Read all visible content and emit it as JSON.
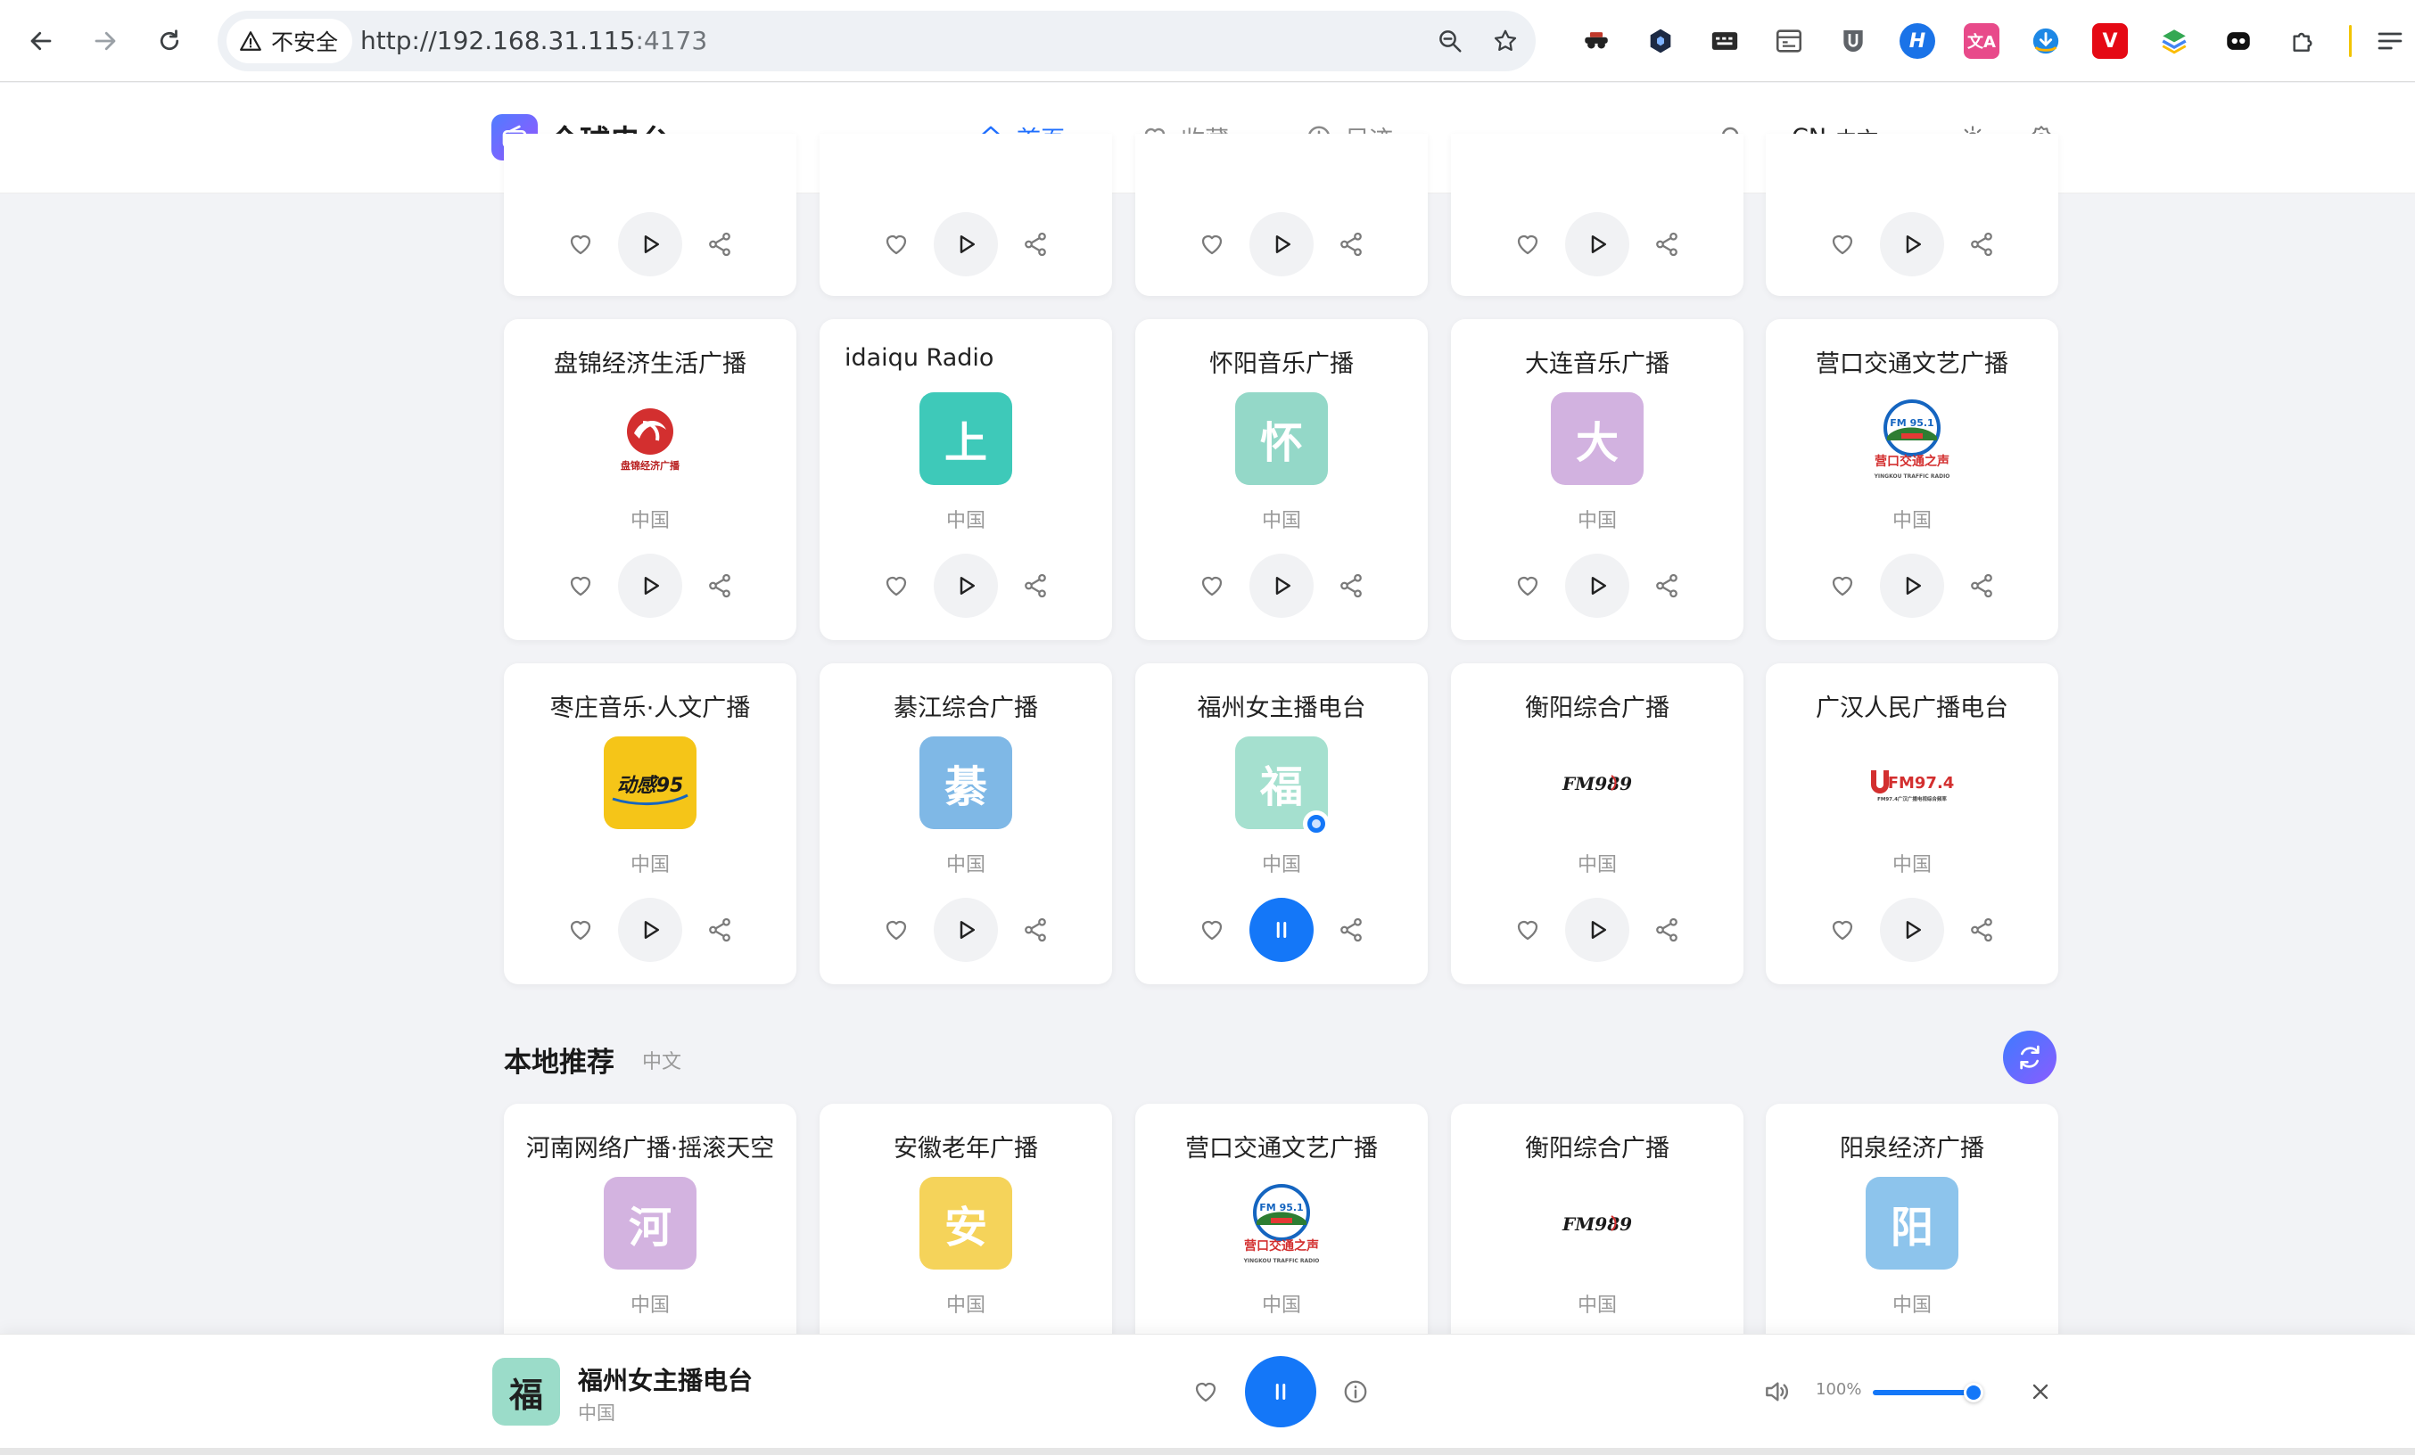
{
  "browser": {
    "security_label": "不安全",
    "url_host": "http://192.168.31.115",
    "url_port": ":4173"
  },
  "header": {
    "logo_text": "全球电台",
    "nav": [
      {
        "label": "首页",
        "active": true
      },
      {
        "label": "收藏",
        "active": false
      },
      {
        "label": "足迹",
        "active": false
      }
    ],
    "lang_code": "CN",
    "lang_label": "中文"
  },
  "grid": {
    "rows": [
      {
        "cards": [
          {
            "name": "",
            "country": "",
            "playing": false
          },
          {
            "name": "",
            "country": "",
            "playing": false
          },
          {
            "name": "",
            "country": "",
            "playing": false
          },
          {
            "name": "",
            "country": "",
            "playing": false
          },
          {
            "name": "",
            "country": "",
            "playing": false
          }
        ]
      },
      {
        "cards": [
          {
            "name": "盘锦经济生活广播",
            "country": "中国",
            "logo_char": "",
            "logo_color": "#ffffff",
            "logo_type": "panjin"
          },
          {
            "name": "idaiqu Radio",
            "country": "中国",
            "logo_char": "上",
            "logo_color": "#3ec9b9",
            "logo_type": "char",
            "align": "left"
          },
          {
            "name": "怀阳音乐广播",
            "country": "中国",
            "logo_char": "怀",
            "logo_color": "#94d8c8",
            "logo_type": "char"
          },
          {
            "name": "大连音乐广播",
            "country": "中国",
            "logo_char": "大",
            "logo_color": "#d2b2e0",
            "logo_type": "char"
          },
          {
            "name": "营口交通文艺广播",
            "country": "中国",
            "logo_char": "",
            "logo_color": "#ffffff",
            "logo_type": "yingkou"
          }
        ]
      },
      {
        "cards": [
          {
            "name": "枣庄音乐·人文广播",
            "country": "中国",
            "logo_char": "",
            "logo_color": "#f5c518",
            "logo_type": "zaozhuang"
          },
          {
            "name": "綦江综合广播",
            "country": "中国",
            "logo_char": "綦",
            "logo_color": "#7fb8e6",
            "logo_type": "char"
          },
          {
            "name": "福州女主播电台",
            "country": "中国",
            "logo_char": "福",
            "logo_color": "#a5e0cf",
            "logo_type": "char",
            "playing": true
          },
          {
            "name": "衡阳综合广播",
            "country": "中国",
            "logo_char": "",
            "logo_color": "#ffffff",
            "logo_type": "hengyang"
          },
          {
            "name": "广汉人民广播电台",
            "country": "中国",
            "logo_char": "",
            "logo_color": "#ffffff",
            "logo_type": "guanghan"
          }
        ]
      }
    ]
  },
  "local_section": {
    "title": "本地推荐",
    "subtitle": "中文",
    "cards": [
      {
        "name": "河南网络广播·摇滚天空",
        "country": "中国",
        "logo_char": "河",
        "logo_color": "#d3b3e0",
        "logo_type": "char"
      },
      {
        "name": "安徽老年广播",
        "country": "中国",
        "logo_char": "安",
        "logo_color": "#f5d35a",
        "logo_type": "char"
      },
      {
        "name": "营口交通文艺广播",
        "country": "中国",
        "logo_char": "",
        "logo_color": "#ffffff",
        "logo_type": "yingkou"
      },
      {
        "name": "衡阳综合广播",
        "country": "中国",
        "logo_char": "",
        "logo_color": "#ffffff",
        "logo_type": "hengyang"
      },
      {
        "name": "阳泉经济广播",
        "country": "中国",
        "logo_char": "阳",
        "logo_color": "#8dc4ec",
        "logo_type": "char"
      }
    ]
  },
  "logo_texts": {
    "zaozhuang": "动感95",
    "hengyang": "FM989",
    "guanghan_main": "FM97.4",
    "guanghan_sub": "FM97.4广汉广播电视综合频率",
    "yingkou_main": "营口交通之声",
    "yingkou_sub": "YINGKOU TRAFFIC RADIO",
    "yingkou_fm": "FM 95.1",
    "panjin_sub": "盘锦经济广播"
  },
  "player": {
    "logo_char": "福",
    "name": "福州女主播电台",
    "country": "中国",
    "volume_label": "100%",
    "volume": 1.0
  },
  "colors": {
    "accent": "#1477f8",
    "nav_active": "#1f6fff"
  }
}
